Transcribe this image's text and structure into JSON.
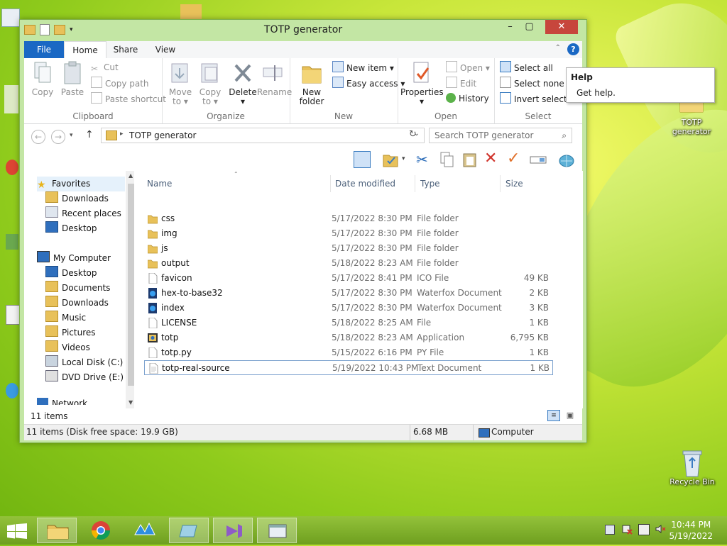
{
  "window": {
    "title": "TOTP generator"
  },
  "ribbon_tabs": [
    "File",
    "Home",
    "Share",
    "View"
  ],
  "ribbon": {
    "clipboard": {
      "label": "Clipboard",
      "copy": "Copy",
      "paste": "Paste",
      "cut": "Cut",
      "copy_path": "Copy path",
      "paste_shortcut": "Paste shortcut"
    },
    "organize": {
      "label": "Organize",
      "move_to_1": "Move",
      "move_to_2": "to",
      "copy_to_1": "Copy",
      "copy_to_2": "to",
      "delete": "Delete",
      "rename": "Rename"
    },
    "new": {
      "label": "New",
      "new_folder_1": "New",
      "new_folder_2": "folder",
      "new_item": "New item",
      "easy_access": "Easy access"
    },
    "open": {
      "label": "Open",
      "properties": "Properties",
      "open": "Open",
      "edit": "Edit",
      "history": "History"
    },
    "select": {
      "label": "Select",
      "select_all": "Select all",
      "select_none": "Select none",
      "invert": "Invert selectio"
    }
  },
  "help_tip": {
    "title": "Help",
    "text": "Get help."
  },
  "address": {
    "path": "TOTP generator",
    "search_placeholder": "Search TOTP generator"
  },
  "nav": {
    "favorites": "Favorites",
    "fav_items": [
      "Downloads",
      "Recent places",
      "Desktop"
    ],
    "computer": "My Computer",
    "comp_items": [
      "Desktop",
      "Documents",
      "Downloads",
      "Music",
      "Pictures",
      "Videos",
      "Local Disk (C:)",
      "DVD Drive (E:) CC"
    ],
    "network_partial": "Network"
  },
  "columns": {
    "name": "Name",
    "date": "Date modified",
    "type": "Type",
    "size": "Size"
  },
  "files": [
    {
      "name": "css",
      "date": "5/17/2022 8:30 PM",
      "type": "File folder",
      "size": "",
      "icon": "folder"
    },
    {
      "name": "img",
      "date": "5/17/2022 8:30 PM",
      "type": "File folder",
      "size": "",
      "icon": "folder"
    },
    {
      "name": "js",
      "date": "5/17/2022 8:30 PM",
      "type": "File folder",
      "size": "",
      "icon": "folder"
    },
    {
      "name": "output",
      "date": "5/18/2022 8:23 AM",
      "type": "File folder",
      "size": "",
      "icon": "folder"
    },
    {
      "name": "favicon",
      "date": "5/17/2022 8:41 PM",
      "type": "ICO File",
      "size": "49 KB",
      "icon": "file"
    },
    {
      "name": "hex-to-base32",
      "date": "5/17/2022 8:30 PM",
      "type": "Waterfox Document",
      "size": "2 KB",
      "icon": "waterfox"
    },
    {
      "name": "index",
      "date": "5/17/2022 8:30 PM",
      "type": "Waterfox Document",
      "size": "3 KB",
      "icon": "waterfox"
    },
    {
      "name": "LICENSE",
      "date": "5/18/2022 8:25 AM",
      "type": "File",
      "size": "1 KB",
      "icon": "file"
    },
    {
      "name": "totp",
      "date": "5/18/2022 8:23 AM",
      "type": "Application",
      "size": "6,795 KB",
      "icon": "app"
    },
    {
      "name": "totp.py",
      "date": "5/15/2022 6:16 PM",
      "type": "PY File",
      "size": "1 KB",
      "icon": "file"
    },
    {
      "name": "totp-real-source",
      "date": "5/19/2022 10:43 PM",
      "type": "Text Document",
      "size": "1 KB",
      "icon": "text"
    }
  ],
  "status": {
    "items_count": "11 items",
    "bar_left": "11 items (Disk free space: 19.9 GB)",
    "bar_size": "6.68 MB",
    "bar_location": "Computer"
  },
  "desktop": {
    "totp_icon": "TOTP generator",
    "recycle_bin": "Recycle Bin"
  },
  "clock": {
    "time": "10:44 PM",
    "date": "5/19/2022"
  },
  "colors": {
    "accent": "#1a68c4",
    "window_frame": "#c3e6a4",
    "taskbar": "#7fb12a",
    "close": "#c7463c",
    "folder": "#e8c15a"
  }
}
